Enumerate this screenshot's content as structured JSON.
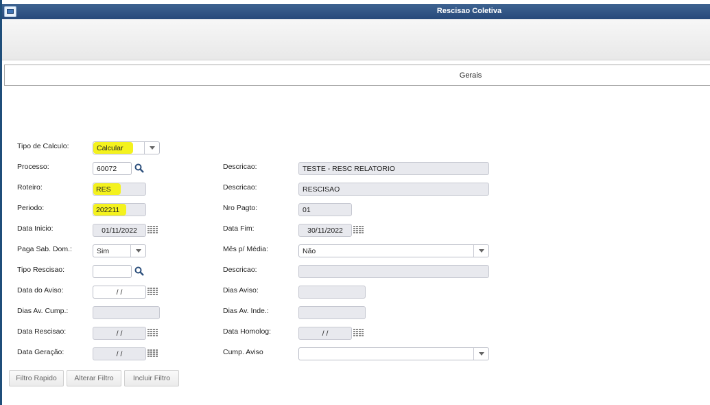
{
  "window": {
    "title": "Rescisao Coletiva"
  },
  "tabs": [
    {
      "label": "Gerais"
    }
  ],
  "form": {
    "tipo_calculo": {
      "label": "Tipo de Calculo:",
      "value": "Calcular"
    },
    "processo": {
      "label": "Processo:",
      "value": "60072"
    },
    "descricao_processo": {
      "label": "Descricao:",
      "value": "TESTE - RESC RELATORIO"
    },
    "roteiro": {
      "label": "Roteiro:",
      "value": "RES"
    },
    "descricao_roteiro": {
      "label": "Descricao:",
      "value": "RESCISAO"
    },
    "periodo": {
      "label": "Periodo:",
      "value": "202211"
    },
    "nro_pagto": {
      "label": "Nro Pagto:",
      "value": "01"
    },
    "data_inicio": {
      "label": "Data Inicio:",
      "value": "01/11/2022"
    },
    "data_fim": {
      "label": "Data Fim:",
      "value": "30/11/2022"
    },
    "paga_sab_dom": {
      "label": "Paga Sab. Dom.:",
      "value": "Sim"
    },
    "mes_media": {
      "label": "Mês p/ Média:",
      "value": "Não"
    },
    "tipo_rescisao": {
      "label": "Tipo Rescisao:",
      "value": ""
    },
    "descricao_rescisao": {
      "label": "Descricao:",
      "value": ""
    },
    "data_aviso": {
      "label": "Data do Aviso:",
      "value": "/ /"
    },
    "dias_aviso": {
      "label": "Dias Aviso:",
      "value": ""
    },
    "dias_av_cump": {
      "label": "Dias Av. Cump.:",
      "value": ""
    },
    "dias_av_inde": {
      "label": "Dias Av. Inde.:",
      "value": ""
    },
    "data_rescisao": {
      "label": "Data Rescisao:",
      "value": "/ /"
    },
    "data_homolog": {
      "label": "Data Homolog:",
      "value": "/ /"
    },
    "data_geracao": {
      "label": "Data Geração:",
      "value": "/ /"
    },
    "cump_aviso": {
      "label": "Cump. Aviso",
      "value": ""
    }
  },
  "buttons": {
    "filtro_rapido": "Filtro Rapido",
    "alterar_filtro": "Alterar Filtro",
    "incluir_filtro": "Incluir Filtro"
  },
  "colors": {
    "titlebar": "#2f5283",
    "highlight": "#f4f21e",
    "field_bg": "#e8e9ee"
  },
  "icons": [
    "window-icon",
    "search-icon",
    "calendar-icon",
    "chevron-down-icon"
  ]
}
